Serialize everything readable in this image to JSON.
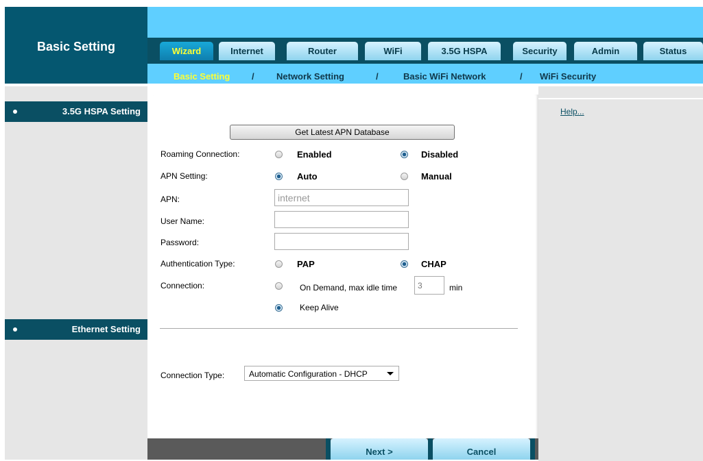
{
  "page_title": "Basic Setting",
  "tabs": [
    "Wizard",
    "Internet",
    "Router",
    "WiFi",
    "3.5G HSPA",
    "Security",
    "Admin",
    "Status"
  ],
  "active_tab": "Wizard",
  "subnav": [
    "Basic Setting",
    "Network Setting",
    "Basic WiFi Network",
    "WiFi Security"
  ],
  "subnav_separator": "/",
  "active_subnav": "Basic Setting",
  "sidebar": {
    "section1": "3.5G HSPA Setting",
    "section2": "Ethernet Setting"
  },
  "help_link": "Help...",
  "form": {
    "apn_db_button": "Get Latest APN Database",
    "roaming": {
      "label": "Roaming Connection:",
      "opt1": "Enabled",
      "opt2": "Disabled",
      "selected": "Disabled"
    },
    "apn_setting": {
      "label": "APN Setting:",
      "opt1": "Auto",
      "opt2": "Manual",
      "selected": "Auto"
    },
    "apn": {
      "label": "APN:",
      "value": "internet"
    },
    "username": {
      "label": "User Name:",
      "value": ""
    },
    "password": {
      "label": "Password:",
      "value": ""
    },
    "auth_type": {
      "label": "Authentication Type:",
      "opt1": "PAP",
      "opt2": "CHAP",
      "selected": "CHAP"
    },
    "connection": {
      "label": "Connection:",
      "opt1": "On Demand, max idle time",
      "idle_value": "3",
      "idle_unit": "min",
      "opt2": "Keep Alive",
      "selected": "Keep Alive"
    },
    "connection_type": {
      "label": "Connection Type:",
      "value": "Automatic Configuration - DHCP"
    }
  },
  "footer": {
    "next": "Next >",
    "cancel": "Cancel"
  },
  "colors": {
    "dark_teal": "#0a4f63",
    "header_blue": "#5fcfff",
    "active_yellow": "#ffff33",
    "panel_grey": "#e6e6e6"
  }
}
